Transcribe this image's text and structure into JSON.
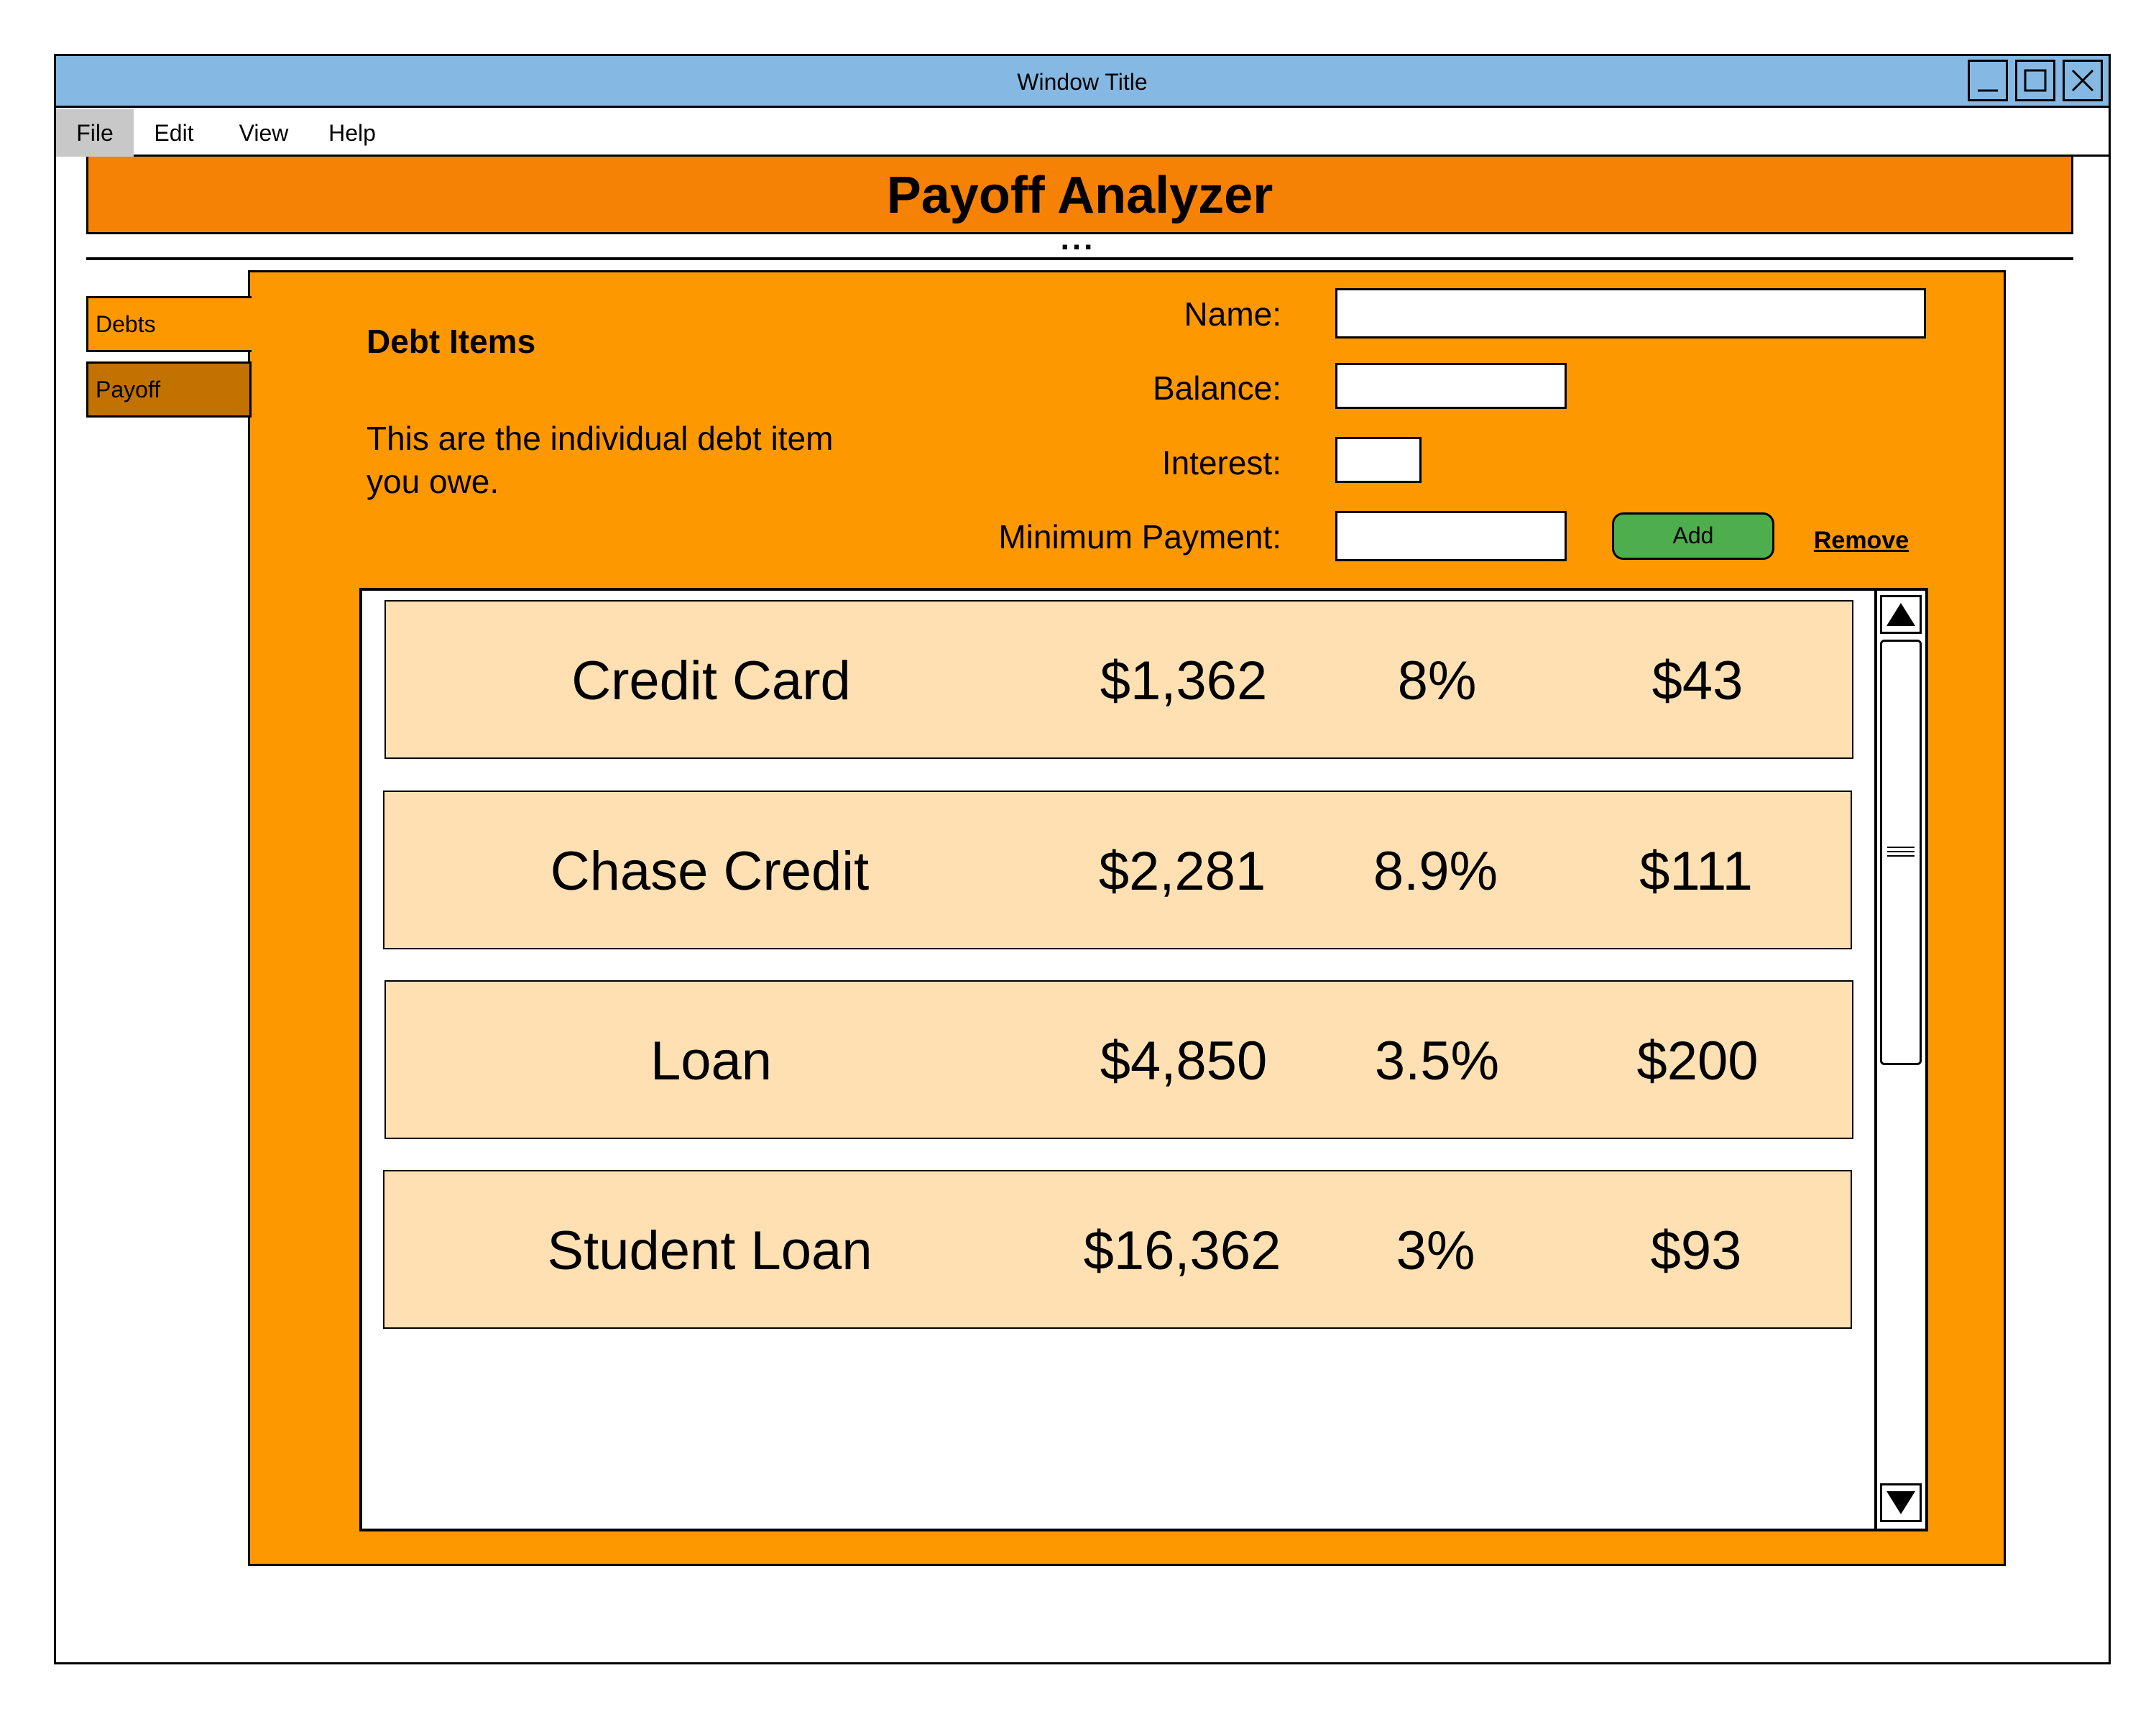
{
  "window": {
    "title": "Window Title",
    "controls": [
      "minimize-icon",
      "maximize-icon",
      "close-icon"
    ]
  },
  "menu": {
    "items": [
      {
        "label": "File",
        "selected": true
      },
      {
        "label": "Edit"
      },
      {
        "label": "View"
      },
      {
        "label": "Help"
      }
    ]
  },
  "header": {
    "title": "Payoff Analyzer",
    "ellipsis": "..."
  },
  "tabs": [
    {
      "label": "Debts",
      "active": true
    },
    {
      "label": "Payoff",
      "active": false
    }
  ],
  "section": {
    "heading": "Debt Items",
    "description": "This are the individual debt item you owe."
  },
  "form": {
    "name_label": "Name:",
    "balance_label": "Balance:",
    "interest_label": "Interest:",
    "min_payment_label": "Minimum Payment:",
    "name_value": "",
    "balance_value": "",
    "interest_value": "",
    "min_payment_value": "",
    "add_label": "Add",
    "remove_label": "Remove"
  },
  "debts": [
    {
      "name": "Credit Card",
      "balance": "$1,362",
      "interest": "8%",
      "min_payment": "$43"
    },
    {
      "name": "Chase Credit",
      "balance": "$2,281",
      "interest": "8.9%",
      "min_payment": "$111"
    },
    {
      "name": "Loan",
      "balance": "$4,850",
      "interest": "3.5%",
      "min_payment": "$200"
    },
    {
      "name": "Student Loan",
      "balance": "$16,362",
      "interest": "3%",
      "min_payment": "$93"
    }
  ],
  "colors": {
    "titlebar": "#85b9e4",
    "banner": "#f58105",
    "panel": "#fe9800",
    "tab_inactive": "#c17200",
    "row": "#fee0b3",
    "add_button": "#4cae4c"
  }
}
